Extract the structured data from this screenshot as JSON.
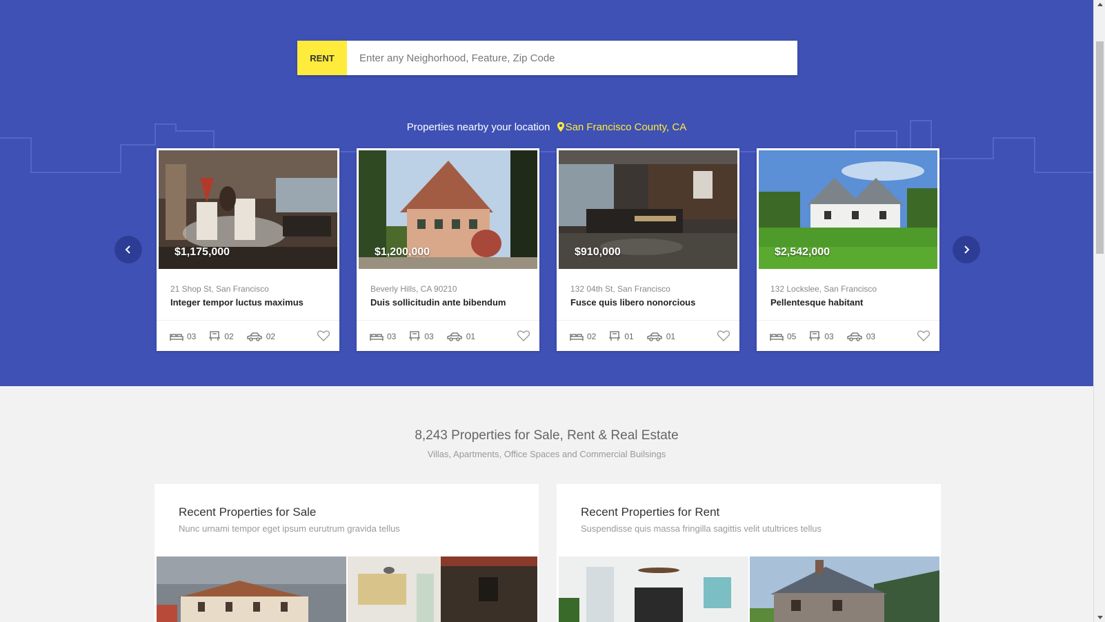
{
  "search": {
    "tag": "RENT",
    "placeholder": "Enter any Neighorhood, Feature, Zip Code"
  },
  "nearby": {
    "label": "Properties nearby your location",
    "location": "San Francisco County, CA"
  },
  "cards": [
    {
      "price": "$1,175,000",
      "address": "21 Shop St, San Francisco",
      "title": "Integer tempor luctus maximus",
      "beds": "03",
      "baths": "02",
      "garage": "02"
    },
    {
      "price": "$1,200,000",
      "address": "Beverly Hills, CA 90210",
      "title": "Duis sollicitudin ante bibendum",
      "beds": "03",
      "baths": "03",
      "garage": "01"
    },
    {
      "price": "$910,000",
      "address": "132 04th St, San Francisco",
      "title": "Fusce quis libero nonorcious",
      "beds": "02",
      "baths": "01",
      "garage": "01"
    },
    {
      "price": "$2,542,000",
      "address": "132 Lockslee, San Francisco",
      "title": "Pellentesque habitant",
      "beds": "05",
      "baths": "03",
      "garage": "03"
    }
  ],
  "stats": {
    "title": "8,243 Properties for Sale, Rent & Real Estate",
    "subtitle": "Villas, Apartments, Office Spaces and Commercial Builsings"
  },
  "sale": {
    "title": "Recent Properties for Sale",
    "subtitle": "Nunc urnami tempor eget ipsum eurutrum gravida tellus"
  },
  "rent": {
    "title": "Recent Properties for Rent",
    "subtitle": "Suspendisse quis massa fringilla sagittis velit utultrices tellus"
  },
  "colors": {
    "hero": "#3f51b5",
    "accent": "#ffeb3b",
    "background": "#f2f2f2"
  },
  "icons": {
    "bed": "bed-icon",
    "bath": "bathtub-icon",
    "garage": "car-icon",
    "favorite": "heart-icon",
    "location": "map-pin-icon",
    "prev": "chevron-left-icon",
    "next": "chevron-right-icon"
  }
}
